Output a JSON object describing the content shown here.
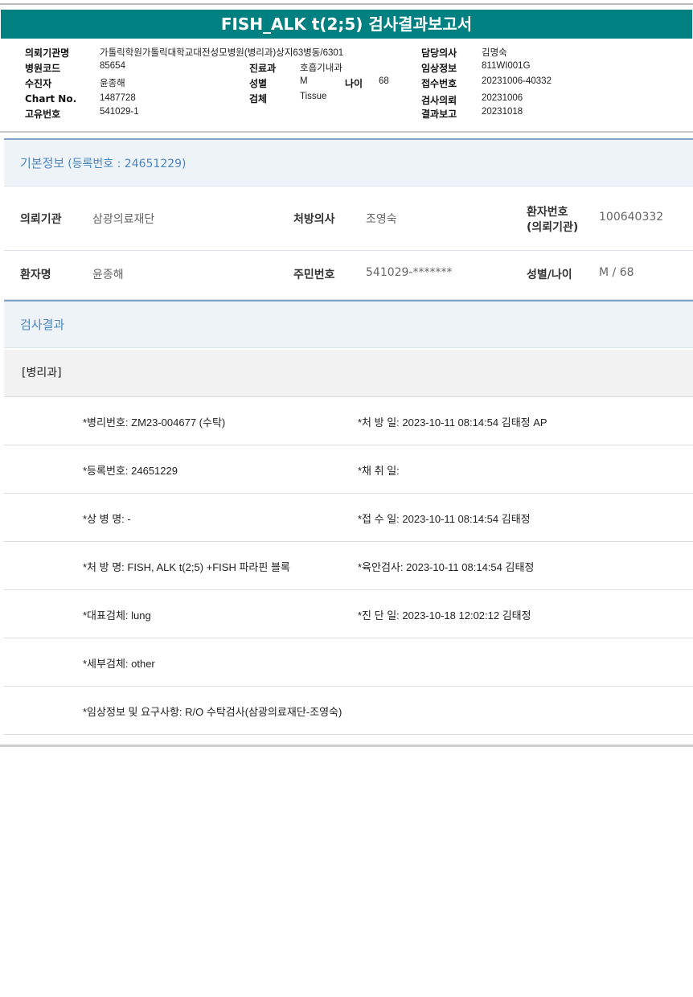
{
  "title": "FISH_ALK t(2;5) 검사결과보고서",
  "header": {
    "institution_label": "의뢰기관명",
    "institution": "가톨릭학원가톨릭대학교대전성모병원(병리과)상지63병동/6301",
    "hospital_code_label": "병원코드",
    "hospital_code": "85654",
    "patient_label": "수진자",
    "patient": "윤종해",
    "chart_label": "Chart No.",
    "chart": "1487728",
    "unique_label": "고유번호",
    "unique": "541029-1",
    "dept_label": "진료과",
    "dept": "호흡기내과",
    "sex_label": "성별",
    "sex": "M",
    "age_label": "나이",
    "age": "68",
    "specimen_label": "검체",
    "specimen": "Tissue",
    "doctor_label": "담당의사",
    "doctor": "김명숙",
    "clinical_label": "임상정보",
    "clinical": "811WI001G",
    "receipt_label": "접수번호",
    "receipt": "20231006-40332",
    "request_label": "검사의뢰",
    "request": "20231006",
    "report_label": "결과보고",
    "report": "20231018"
  },
  "basic": {
    "title": "기본정보",
    "subtitle": "(등록번호 : 24651229)",
    "inst_label": "의뢰기관",
    "inst": "삼광의료재단",
    "presc_label": "처방의사",
    "presc": "조영숙",
    "pno_label": "환자번호",
    "pno_label2": "(의뢰기관)",
    "pno": "100640332",
    "name_label": "환자명",
    "name": "윤종해",
    "rrn_label": "주민번호",
    "rrn": "541029-*******",
    "sexage_label": "성별/나이",
    "sexage": "M / 68"
  },
  "results": {
    "title": "검사결과",
    "dept": "[병리과]",
    "rows": [
      {
        "left": "*병리번호: ZM23-004677 (수탁)",
        "right": "*처 방 일: 2023-10-11 08:14:54  김태정 AP"
      },
      {
        "left": "*등록번호: 24651229",
        "right": "*채 취 일:"
      },
      {
        "left": "*상 병 명: -",
        "right": "*접 수 일: 2023-10-11 08:14:54  김태정"
      },
      {
        "left": "*처 방 명: FISH, ALK t(2;5) +FISH 파라핀 블록",
        "right": "*육안검사: 2023-10-11 08:14:54  김태정"
      },
      {
        "left": "*대표검체: lung",
        "right": "*진 단 일: 2023-10-18 12:02:12  김태정"
      },
      {
        "left": "*세부검체: other",
        "right": ""
      },
      {
        "left": "*임상정보 및 요구사항: R/O 수탁검사(삼광의료재단-조영숙)",
        "right": ""
      }
    ]
  }
}
